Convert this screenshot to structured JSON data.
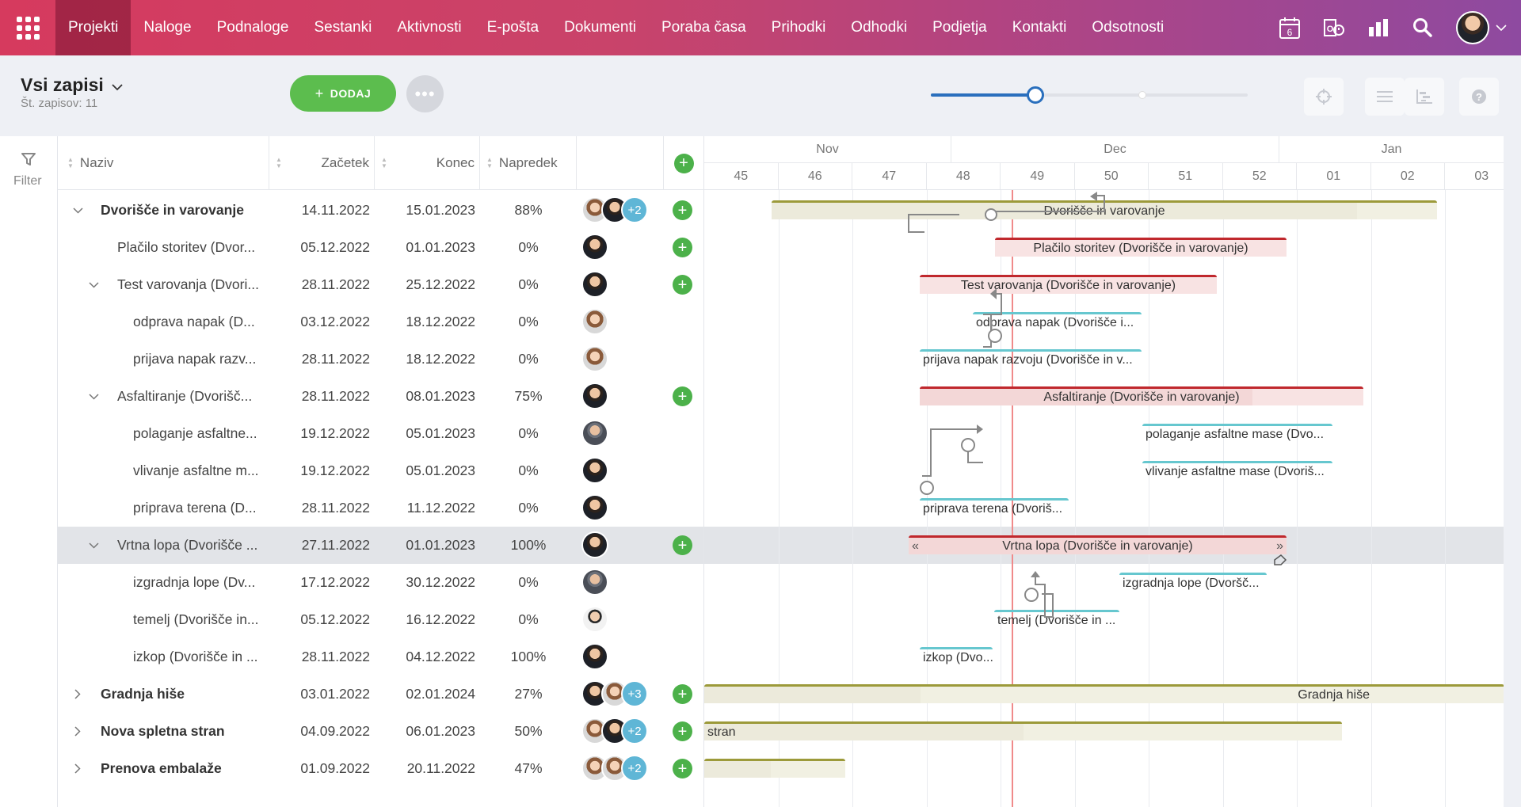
{
  "nav": {
    "items": [
      "Projekti",
      "Naloge",
      "Podnaloge",
      "Sestanki",
      "Aktivnosti",
      "E-pošta",
      "Dokumenti",
      "Poraba časa",
      "Prihodki",
      "Odhodki",
      "Podjetja",
      "Kontakti",
      "Odsotnosti"
    ],
    "active": "Projekti",
    "calendar_day": "6",
    "icons": [
      "apps-grid-icon",
      "calendar-icon",
      "outlook-sync-icon",
      "chart-icon",
      "search-icon",
      "user-avatar",
      "chevron-down-icon"
    ]
  },
  "toolbar": {
    "title": "Vsi zapisi",
    "subtitle": "Št. zapisov: 11",
    "add_label": "DODAJ",
    "more_label": "•••",
    "zoom_fraction": 0.33
  },
  "filter": {
    "label": "Filter"
  },
  "columns": {
    "name": "Naziv",
    "start": "Začetek",
    "end": "Konec",
    "progress": "Napredek"
  },
  "rows": [
    {
      "name": "Dvorišče in varovanje",
      "start": "14.11.2022",
      "end": "15.01.2023",
      "progress": "88%",
      "level": 0,
      "bold": true,
      "toggle": "down",
      "avatars": [
        "f1",
        "m1"
      ],
      "more": "+2",
      "plus": true
    },
    {
      "name": "Plačilo storitev (Dvor...",
      "start": "05.12.2022",
      "end": "01.01.2023",
      "progress": "0%",
      "level": 1,
      "bold": false,
      "toggle": "",
      "avatars": [
        "m1"
      ],
      "more": "",
      "plus": true
    },
    {
      "name": "Test varovanja (Dvori...",
      "start": "28.11.2022",
      "end": "25.12.2022",
      "progress": "0%",
      "level": 1,
      "bold": false,
      "toggle": "down",
      "avatars": [
        "m1"
      ],
      "more": "",
      "plus": true
    },
    {
      "name": "odprava napak (D...",
      "start": "03.12.2022",
      "end": "18.12.2022",
      "progress": "0%",
      "level": 2,
      "bold": false,
      "toggle": "",
      "avatars": [
        "f1"
      ],
      "more": "",
      "plus": false
    },
    {
      "name": "prijava napak razv...",
      "start": "28.11.2022",
      "end": "18.12.2022",
      "progress": "0%",
      "level": 2,
      "bold": false,
      "toggle": "",
      "avatars": [
        "f1"
      ],
      "more": "",
      "plus": false
    },
    {
      "name": "Asfaltiranje (Dvorišč...",
      "start": "28.11.2022",
      "end": "08.01.2023",
      "progress": "75%",
      "level": 1,
      "bold": false,
      "toggle": "down",
      "avatars": [
        "m1"
      ],
      "more": "",
      "plus": true
    },
    {
      "name": "polaganje asfaltne...",
      "start": "19.12.2022",
      "end": "05.01.2023",
      "progress": "0%",
      "level": 2,
      "bold": false,
      "toggle": "",
      "avatars": [
        "m2"
      ],
      "more": "",
      "plus": false
    },
    {
      "name": "vlivanje asfaltne m...",
      "start": "19.12.2022",
      "end": "05.01.2023",
      "progress": "0%",
      "level": 2,
      "bold": false,
      "toggle": "",
      "avatars": [
        "m1"
      ],
      "more": "",
      "plus": false
    },
    {
      "name": "priprava terena (D...",
      "start": "28.11.2022",
      "end": "11.12.2022",
      "progress": "0%",
      "level": 2,
      "bold": false,
      "toggle": "",
      "avatars": [
        "m1"
      ],
      "more": "",
      "plus": false
    },
    {
      "name": "Vrtna lopa (Dvorišče ...",
      "start": "27.11.2022",
      "end": "01.01.2023",
      "progress": "100%",
      "level": 1,
      "bold": false,
      "toggle": "down",
      "avatars": [
        "m1"
      ],
      "more": "",
      "plus": true,
      "selected": true
    },
    {
      "name": "izgradnja lope (Dv...",
      "start": "17.12.2022",
      "end": "30.12.2022",
      "progress": "0%",
      "level": 2,
      "bold": false,
      "toggle": "",
      "avatars": [
        "m2"
      ],
      "more": "",
      "plus": false
    },
    {
      "name": "temelj (Dvorišče in...",
      "start": "05.12.2022",
      "end": "16.12.2022",
      "progress": "0%",
      "level": 2,
      "bold": false,
      "toggle": "",
      "avatars": [
        "w1"
      ],
      "more": "",
      "plus": false
    },
    {
      "name": "izkop (Dvorišče in ...",
      "start": "28.11.2022",
      "end": "04.12.2022",
      "progress": "100%",
      "level": 2,
      "bold": false,
      "toggle": "",
      "avatars": [
        "m1"
      ],
      "more": "",
      "plus": false
    },
    {
      "name": "Gradnja hiše",
      "start": "03.01.2022",
      "end": "02.01.2024",
      "progress": "27%",
      "level": 0,
      "bold": true,
      "toggle": "right",
      "avatars": [
        "m1",
        "f1"
      ],
      "more": "+3",
      "plus": true
    },
    {
      "name": "Nova spletna stran",
      "start": "04.09.2022",
      "end": "06.01.2023",
      "progress": "50%",
      "level": 0,
      "bold": true,
      "toggle": "right",
      "avatars": [
        "f1",
        "m1"
      ],
      "more": "+2",
      "plus": true
    },
    {
      "name": "Prenova embalaže",
      "start": "01.09.2022",
      "end": "20.11.2022",
      "progress": "47%",
      "level": 0,
      "bold": true,
      "toggle": "right",
      "avatars": [
        "f1",
        "f1"
      ],
      "more": "+2",
      "plus": true
    }
  ],
  "gantt": {
    "months": [
      {
        "label": "Nov"
      },
      {
        "label": "Dec"
      },
      {
        "label": "Jan"
      }
    ],
    "weeks": [
      "45",
      "46",
      "47",
      "48",
      "49",
      "50",
      "51",
      "52",
      "01",
      "02",
      "03"
    ],
    "bars": [
      {
        "row": 0,
        "label": "Dvorišče in varovanje",
        "color": "olive",
        "progress": 0.88
      },
      {
        "row": 1,
        "label": "Plačilo storitev (Dvorišče in varovanje)",
        "color": "red",
        "progress": 0
      },
      {
        "row": 2,
        "label": "Test varovanja (Dvorišče in varovanje)",
        "color": "red",
        "progress": 0
      },
      {
        "row": 3,
        "label": "odprava napak (Dvorišče i...",
        "color": "teal",
        "progress": 0
      },
      {
        "row": 4,
        "label": "prijava napak razvoju (Dvorišče in v...",
        "color": "teal",
        "progress": 0
      },
      {
        "row": 5,
        "label": "Asfaltiranje (Dvorišče in varovanje)",
        "color": "red",
        "progress": 0.75
      },
      {
        "row": 6,
        "label": "polaganje asfaltne mase (Dvo...",
        "color": "teal",
        "progress": 0
      },
      {
        "row": 7,
        "label": "vlivanje asfaltne mase (Dvoriš...",
        "color": "teal",
        "progress": 0
      },
      {
        "row": 8,
        "label": "priprava terena (Dvoriš...",
        "color": "teal",
        "progress": 0
      },
      {
        "row": 9,
        "label": "Vrtna lopa (Dvorišče in varovanje)",
        "color": "red",
        "progress": 1.0
      },
      {
        "row": 10,
        "label": "izgradnja lope (Dvoršč...",
        "color": "teal",
        "progress": 0
      },
      {
        "row": 11,
        "label": "temelj (Dvorišče in ...",
        "color": "teal",
        "progress": 0
      },
      {
        "row": 12,
        "label": "izkop (Dvo...",
        "color": "teal",
        "progress": 1.0
      },
      {
        "row": 13,
        "label": "Gradnja hiše",
        "color": "olive",
        "progress": 0.27
      },
      {
        "row": 14,
        "label": "stran",
        "color": "olive",
        "progress": 0.5
      },
      {
        "row": 15,
        "label": "",
        "color": "olive",
        "progress": 0.47
      }
    ]
  }
}
